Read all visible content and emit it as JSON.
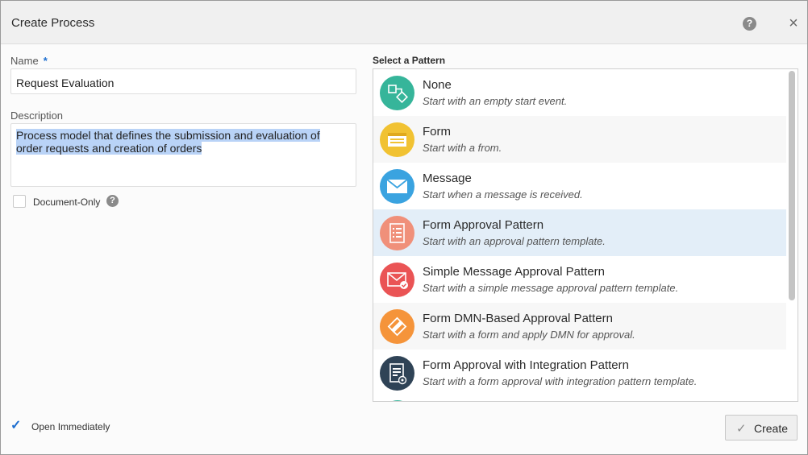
{
  "header": {
    "title": "Create Process",
    "help_icon": "?",
    "close_icon": "×"
  },
  "form": {
    "name_label": "Name",
    "required_mark": "*",
    "name_value": "Request Evaluation",
    "description_label": "Description",
    "description_lines": [
      "Process model that defines the submission and evaluation of",
      "order requests and creation of orders"
    ],
    "document_only_label": "Document-Only",
    "document_only_checked": false,
    "open_immediately_label": "Open Immediately",
    "open_immediately_checked": true
  },
  "patterns": {
    "title": "Select a Pattern",
    "selected_index": 3,
    "items": [
      {
        "title": "None",
        "description": "Start with an empty start event.",
        "icon": "flow-icon",
        "color": "#36b59a"
      },
      {
        "title": "Form",
        "description": "Start with a from.",
        "icon": "form-icon",
        "color": "#f1c232"
      },
      {
        "title": "Message",
        "description": "Start when a message is received.",
        "icon": "envelope-icon",
        "color": "#3aa3e0"
      },
      {
        "title": "Form Approval Pattern",
        "description": "Start with an approval pattern template.",
        "icon": "form-approval-icon",
        "color": "#f0907a"
      },
      {
        "title": "Simple Message Approval Pattern",
        "description": "Start with a simple message approval pattern template.",
        "icon": "message-approval-icon",
        "color": "#ea5455"
      },
      {
        "title": "Form DMN-Based Approval Pattern",
        "description": "Start with a form and apply DMN for approval.",
        "icon": "dmn-icon",
        "color": "#f5943a"
      },
      {
        "title": "Form Approval with Integration Pattern",
        "description": "Start with a form approval with integration pattern template.",
        "icon": "integration-icon",
        "color": "#2f4356"
      }
    ]
  },
  "footer": {
    "create_label": "Create",
    "check_glyph": "✓"
  }
}
